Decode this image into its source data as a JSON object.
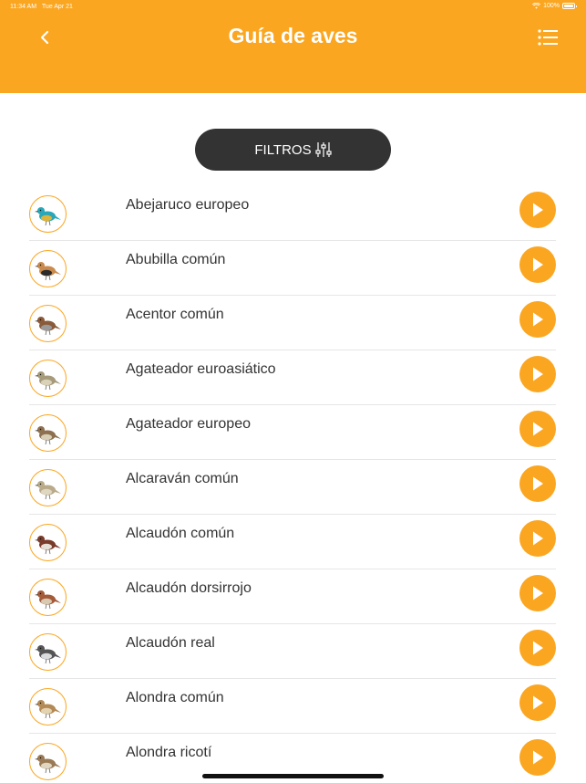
{
  "status_bar": {
    "time": "11:34 AM",
    "date": "Tue Apr 21",
    "battery": "100%"
  },
  "header": {
    "title": "Guía de aves"
  },
  "filter": {
    "label": "FILTROS"
  },
  "birds": [
    {
      "name": "Abejaruco europeo",
      "c1": "#2aa7b8",
      "c2": "#e0b43a"
    },
    {
      "name": "Abubilla común",
      "c1": "#c98b4d",
      "c2": "#2b2b2b"
    },
    {
      "name": "Acentor común",
      "c1": "#8a5a3a",
      "c2": "#9a9a9a"
    },
    {
      "name": "Agateador euroasiático",
      "c1": "#a59a7a",
      "c2": "#d9d2b9"
    },
    {
      "name": "Agateador europeo",
      "c1": "#8c7050",
      "c2": "#d8cfb6"
    },
    {
      "name": "Alcaraván común",
      "c1": "#b9aa8a",
      "c2": "#e0d7c0"
    },
    {
      "name": "Alcaudón común",
      "c1": "#7a3b2a",
      "c2": "#e6e1d6"
    },
    {
      "name": "Alcaudón dorsirrojo",
      "c1": "#a35b3a",
      "c2": "#d9c9b0"
    },
    {
      "name": "Alcaudón real",
      "c1": "#555555",
      "c2": "#dcdcdc"
    },
    {
      "name": "Alondra común",
      "c1": "#b38a55",
      "c2": "#e3d3b0"
    },
    {
      "name": "Alondra ricotí",
      "c1": "#9a7a55",
      "c2": "#e1d6c0"
    }
  ]
}
